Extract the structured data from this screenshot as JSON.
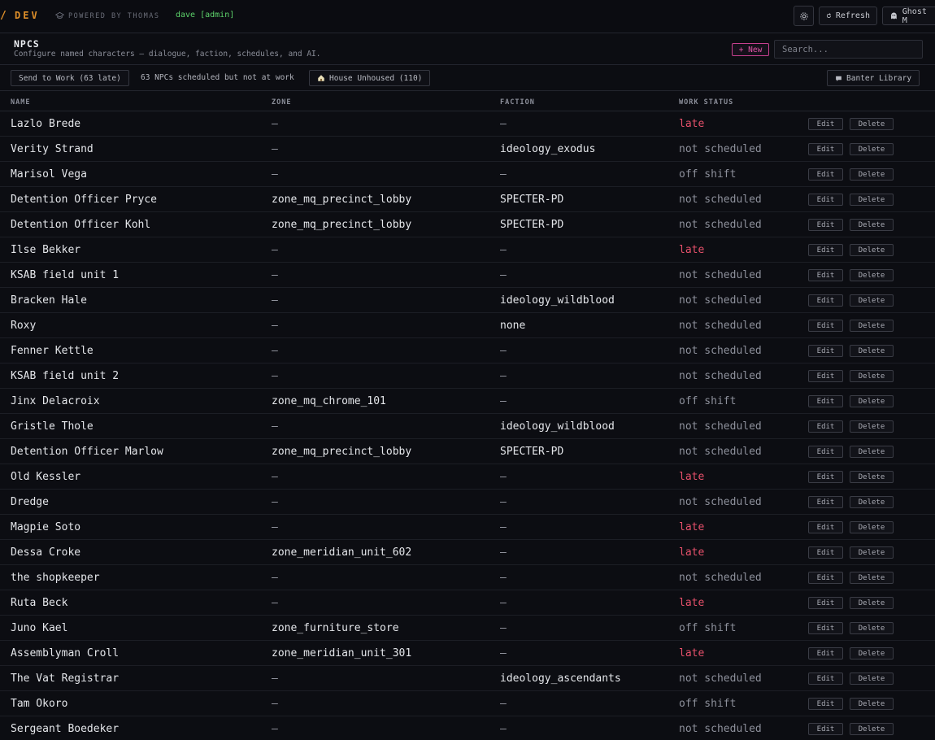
{
  "brand": {
    "slash": "/",
    "name": "DEV",
    "powered": "POWERED BY THOMAS",
    "user": "dave [admin]"
  },
  "topbar": {
    "refresh_label": "Refresh",
    "ghost_label": "Ghost M"
  },
  "header": {
    "title": "NPCS",
    "subtitle": "Configure named characters — dialogue, faction, schedules, and AI.",
    "new_label": "+ New",
    "search_placeholder": "Search..."
  },
  "actionbar": {
    "send_label": "Send to Work (63 late)",
    "status_text": "63 NPCs scheduled but not at work",
    "house_label": "House Unhoused (110)",
    "banter_label": "Banter Library"
  },
  "table": {
    "columns": {
      "name": "NAME",
      "zone": "ZONE",
      "faction": "FACTION",
      "status": "WORK STATUS"
    },
    "edit_label": "Edit",
    "delete_label": "Delete",
    "rows": [
      {
        "name": "Lazlo Brede",
        "zone": "—",
        "faction": "—",
        "status": "late"
      },
      {
        "name": "Verity Strand",
        "zone": "—",
        "faction": "ideology_exodus",
        "status": "not scheduled"
      },
      {
        "name": "Marisol Vega",
        "zone": "—",
        "faction": "—",
        "status": "off shift"
      },
      {
        "name": "Detention Officer Pryce",
        "zone": "zone_mq_precinct_lobby",
        "faction": "SPECTER-PD",
        "status": "not scheduled"
      },
      {
        "name": "Detention Officer Kohl",
        "zone": "zone_mq_precinct_lobby",
        "faction": "SPECTER-PD",
        "status": "not scheduled"
      },
      {
        "name": "Ilse Bekker",
        "zone": "—",
        "faction": "—",
        "status": "late"
      },
      {
        "name": "KSAB field unit 1",
        "zone": "—",
        "faction": "—",
        "status": "not scheduled"
      },
      {
        "name": "Bracken Hale",
        "zone": "—",
        "faction": "ideology_wildblood",
        "status": "not scheduled"
      },
      {
        "name": "Roxy",
        "zone": "—",
        "faction": "none",
        "status": "not scheduled"
      },
      {
        "name": "Fenner Kettle",
        "zone": "—",
        "faction": "—",
        "status": "not scheduled"
      },
      {
        "name": "KSAB field unit 2",
        "zone": "—",
        "faction": "—",
        "status": "not scheduled"
      },
      {
        "name": "Jinx Delacroix",
        "zone": "zone_mq_chrome_101",
        "faction": "—",
        "status": "off shift"
      },
      {
        "name": "Gristle Thole",
        "zone": "—",
        "faction": "ideology_wildblood",
        "status": "not scheduled"
      },
      {
        "name": "Detention Officer Marlow",
        "zone": "zone_mq_precinct_lobby",
        "faction": "SPECTER-PD",
        "status": "not scheduled"
      },
      {
        "name": "Old Kessler",
        "zone": "—",
        "faction": "—",
        "status": "late"
      },
      {
        "name": "Dredge",
        "zone": "—",
        "faction": "—",
        "status": "not scheduled"
      },
      {
        "name": "Magpie Soto",
        "zone": "—",
        "faction": "—",
        "status": "late"
      },
      {
        "name": "Dessa Croke",
        "zone": "zone_meridian_unit_602",
        "faction": "—",
        "status": "late"
      },
      {
        "name": "the shopkeeper",
        "zone": "—",
        "faction": "—",
        "status": "not scheduled"
      },
      {
        "name": "Ruta Beck",
        "zone": "—",
        "faction": "—",
        "status": "late"
      },
      {
        "name": "Juno Kael",
        "zone": "zone_furniture_store",
        "faction": "—",
        "status": "off shift"
      },
      {
        "name": "Assemblyman Croll",
        "zone": "zone_meridian_unit_301",
        "faction": "—",
        "status": "late"
      },
      {
        "name": "The Vat Registrar",
        "zone": "—",
        "faction": "ideology_ascendants",
        "status": "not scheduled"
      },
      {
        "name": "Tam Okoro",
        "zone": "—",
        "faction": "—",
        "status": "off shift"
      },
      {
        "name": "Sergeant Boedeker",
        "zone": "—",
        "faction": "—",
        "status": "not scheduled"
      }
    ]
  },
  "colors": {
    "accent": "#e0902a",
    "late": "#e5506a",
    "admin": "#5dd36b",
    "new": "#e255a8"
  }
}
